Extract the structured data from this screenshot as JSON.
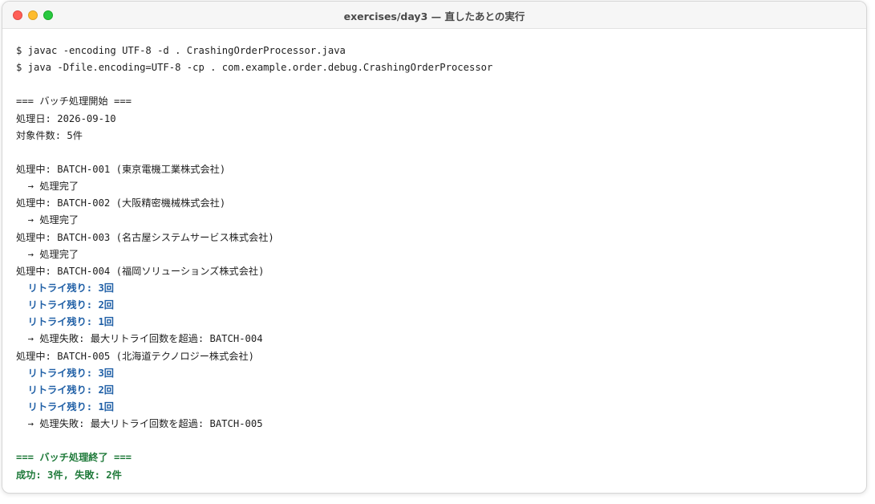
{
  "window": {
    "title": "exercises/day3 — 直したあとの実行"
  },
  "terminal": {
    "lines": [
      "$ javac -encoding UTF-8 -d . CrashingOrderProcessor.java",
      "$ java -Dfile.encoding=UTF-8 -cp . com.example.order.debug.CrashingOrderProcessor",
      "",
      "=== バッチ処理開始 ===",
      "処理日: 2026-09-10",
      "対象件数: 5件",
      "",
      "処理中: BATCH-001 (東京電機工業株式会社)",
      "  → 処理完了",
      "処理中: BATCH-002 (大阪精密機械株式会社)",
      "  → 処理完了",
      "処理中: BATCH-003 (名古屋システムサービス株式会社)",
      "  → 処理完了",
      "処理中: BATCH-004 (福岡ソリューションズ株式会社)",
      "  リトライ残り: 3回",
      "  リトライ残り: 2回",
      "  リトライ残り: 1回",
      "  → 処理失敗: 最大リトライ回数を超過: BATCH-004",
      "処理中: BATCH-005 (北海道テクノロジー株式会社)",
      "  リトライ残り: 3回",
      "  リトライ残り: 2回",
      "  リトライ残り: 1回",
      "  → 処理失敗: 最大リトライ回数を超過: BATCH-005",
      "",
      "=== バッチ処理終了 ===",
      "成功: 3件, 失敗: 2件"
    ]
  },
  "colors": {
    "retry": "#1f5fa6",
    "summary": "#1f7a3a",
    "close": "#ff5f57",
    "minimize": "#febc2e",
    "zoom": "#28c840"
  }
}
